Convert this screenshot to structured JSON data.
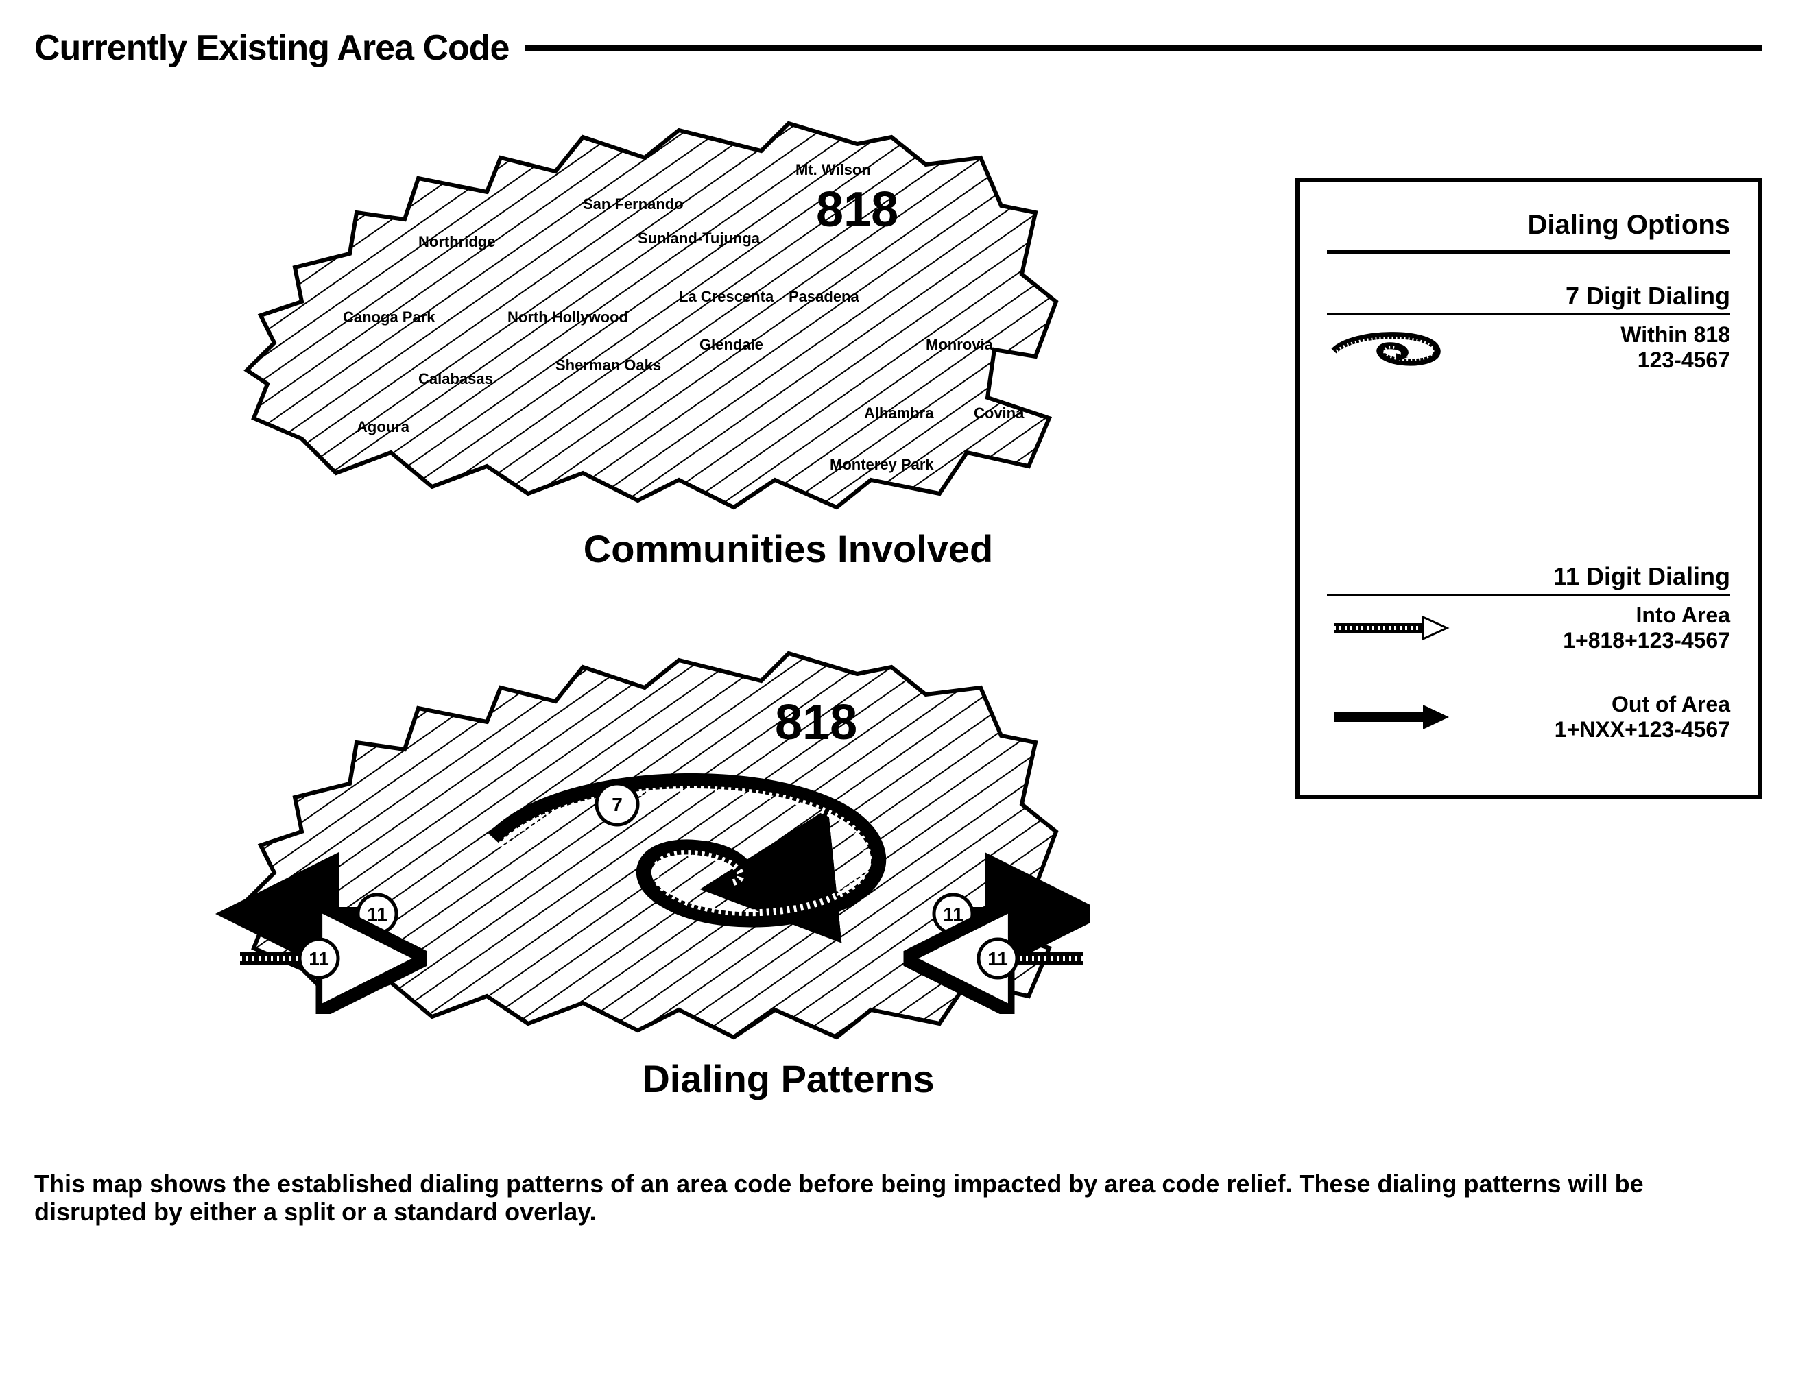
{
  "header": {
    "title": "Currently Existing Area Code"
  },
  "map1": {
    "area_code": "818",
    "caption": "Communities Involved",
    "cities": [
      "Mt. Wilson",
      "San Fernando",
      "Northridge",
      "Sunland-Tujunga",
      "La Crescenta",
      "Pasadena",
      "Canoga Park",
      "North Hollywood",
      "Glendale",
      "Monrovia",
      "Sherman Oaks",
      "Calabasas",
      "Alhambra",
      "Covina",
      "Agoura",
      "Monterey Park"
    ]
  },
  "map2": {
    "area_code": "818",
    "caption": "Dialing Patterns",
    "badges": {
      "inner": "7",
      "outer": "11"
    }
  },
  "legend": {
    "title": "Dialing Options",
    "seven": {
      "heading": "7 Digit Dialing",
      "row_label": "Within 818",
      "row_example": "123-4567"
    },
    "eleven": {
      "heading": "11 Digit Dialing",
      "into_label": "Into Area",
      "into_example": "1+818+123-4567",
      "out_label": "Out of Area",
      "out_example": "1+NXX+123-4567"
    }
  },
  "caption": "This map shows the established dialing patterns of an area code before being impacted by area code relief. These dialing patterns will be disrupted by either a split or a standard overlay."
}
